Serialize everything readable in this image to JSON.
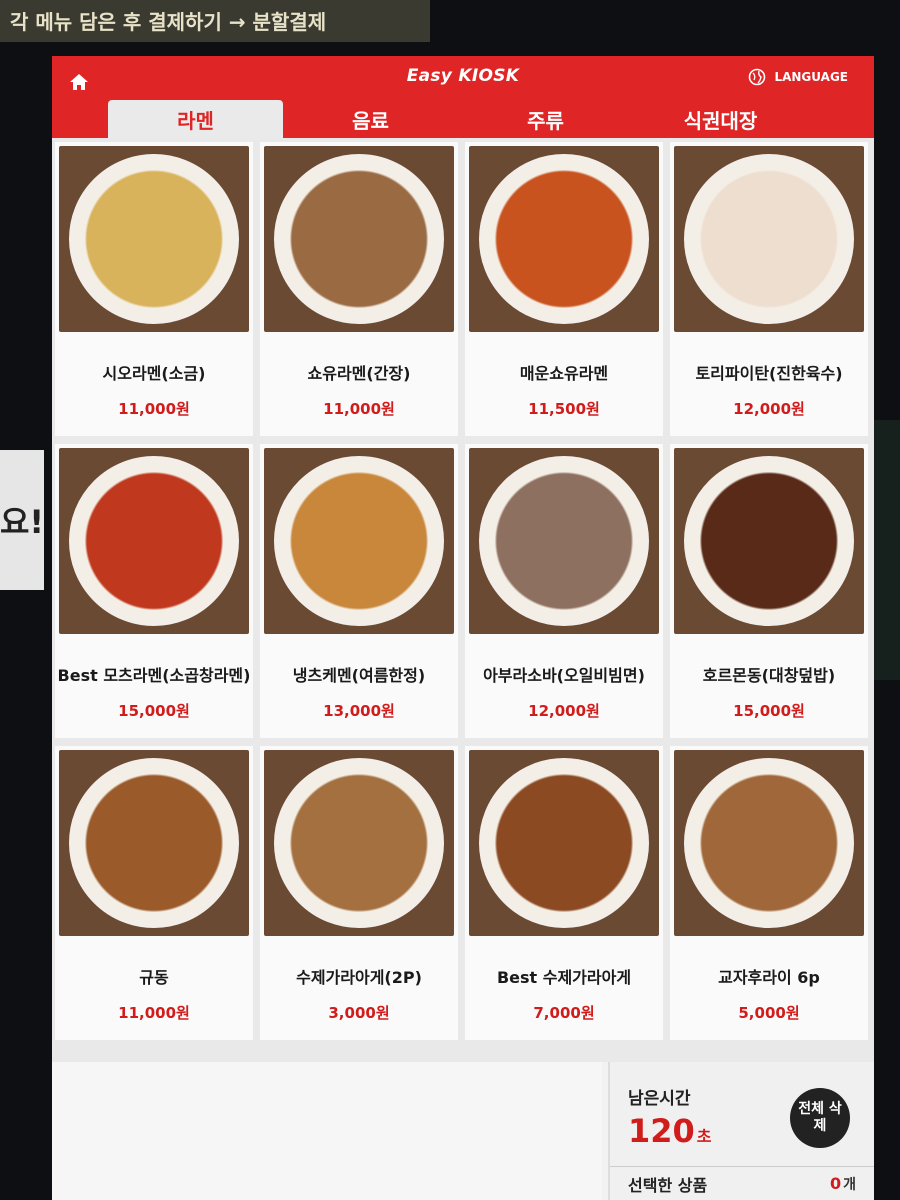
{
  "sign_text": "각 메뉴 담은 후 결제하기 → 분할결제",
  "side_note": "요!",
  "header": {
    "brand": "Easy KIOSK",
    "language_label": "LANGUAGE"
  },
  "tabs": [
    {
      "label": "라멘"
    },
    {
      "label": "음료"
    },
    {
      "label": "주류"
    },
    {
      "label": "식권대장"
    }
  ],
  "items": [
    {
      "name": "시오라멘(소금)",
      "price": "11,000원",
      "color": "#d9b25c"
    },
    {
      "name": "쇼유라멘(간장)",
      "price": "11,000원",
      "color": "#9a6a43"
    },
    {
      "name": "매운쇼유라멘",
      "price": "11,500원",
      "color": "#c9531f"
    },
    {
      "name": "토리파이탄(진한육수)",
      "price": "12,000원",
      "color": "#eeded0"
    },
    {
      "name": "Best 모츠라멘(소곱창라멘)",
      "price": "15,000원",
      "color": "#c0391e"
    },
    {
      "name": "냉츠케멘(여름한정)",
      "price": "13,000원",
      "color": "#c9873c"
    },
    {
      "name": "아부라소바(오일비빔면)",
      "price": "12,000원",
      "color": "#8e7060"
    },
    {
      "name": "호르몬동(대창덮밥)",
      "price": "15,000원",
      "color": "#5a2a18"
    },
    {
      "name": "규동",
      "price": "11,000원",
      "color": "#9a5a2a"
    },
    {
      "name": "수제가라아게(2P)",
      "price": "3,000원",
      "color": "#a47040"
    },
    {
      "name": "Best 수제가라아게",
      "price": "7,000원",
      "color": "#8c4a22"
    },
    {
      "name": "교자후라이 6p",
      "price": "5,000원",
      "color": "#a0683a"
    }
  ],
  "footer": {
    "remain_label": "남은시간",
    "remain_value": "120",
    "remain_unit": "초",
    "clear_button": "전체 삭제",
    "selected_label": "선택한 상품",
    "selected_count": "0",
    "selected_unit": "개"
  },
  "colors": {
    "header_red": "#df2525",
    "price_red": "#d11c1c"
  }
}
